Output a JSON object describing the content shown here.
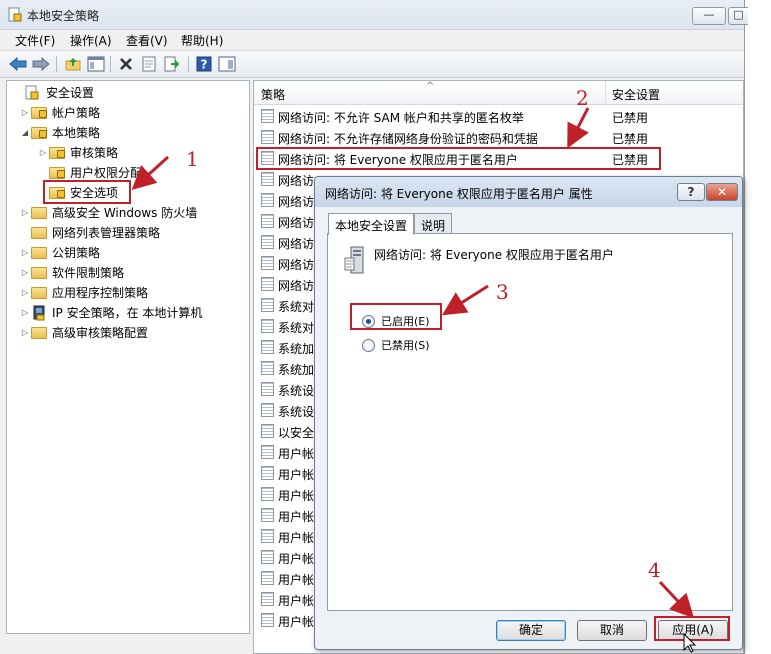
{
  "window": {
    "title": "本地安全策略",
    "minimize": "—",
    "maximize": "□"
  },
  "menu": [
    "文件(F)",
    "操作(A)",
    "查看(V)",
    "帮助(H)"
  ],
  "toolbar": {
    "icons": [
      "back-arrow-icon",
      "forward-arrow-icon",
      "up-folder-icon",
      "show-tree-icon",
      "delete-icon",
      "properties-icon",
      "export-icon",
      "help-icon",
      "panel-icon"
    ],
    "help_glyph": "?"
  },
  "tree": {
    "items": [
      {
        "label": "安全设置",
        "level": 0,
        "expander": "",
        "icon": "security-settings-icon"
      },
      {
        "label": "帐户策略",
        "level": 1,
        "expander": "▷",
        "icon": "folder-icon"
      },
      {
        "label": "本地策略",
        "level": 1,
        "expander": "◢",
        "icon": "folder-icon"
      },
      {
        "label": "审核策略",
        "level": 2,
        "expander": "▷",
        "icon": "folder-icon"
      },
      {
        "label": "用户权限分配",
        "level": 2,
        "expander": "",
        "icon": "folder-icon"
      },
      {
        "label": "安全选项",
        "level": 2,
        "expander": "",
        "icon": "folder-icon",
        "selected": true
      },
      {
        "label": "高级安全 Windows 防火墙",
        "level": 1,
        "expander": "▷",
        "icon": "folder-icon"
      },
      {
        "label": "网络列表管理器策略",
        "level": 1,
        "expander": "",
        "icon": "folder-icon"
      },
      {
        "label": "公钥策略",
        "level": 1,
        "expander": "▷",
        "icon": "folder-icon"
      },
      {
        "label": "软件限制策略",
        "level": 1,
        "expander": "▷",
        "icon": "folder-icon"
      },
      {
        "label": "应用程序控制策略",
        "level": 1,
        "expander": "▷",
        "icon": "folder-icon"
      },
      {
        "label": "IP 安全策略，在 本地计算机",
        "level": 1,
        "expander": "▷",
        "icon": "ip-security-icon"
      },
      {
        "label": "高级审核策略配置",
        "level": 1,
        "expander": "▷",
        "icon": "folder-icon"
      }
    ]
  },
  "list": {
    "columns": {
      "policy": "策略",
      "setting": "安全设置"
    },
    "sort_glyph": "^",
    "rows": [
      {
        "name": "网络访问: 不允许 SAM 帐户和共享的匿名枚举",
        "value": "已禁用"
      },
      {
        "name": "网络访问: 不允许存储网络身份验证的密码和凭据",
        "value": "已禁用"
      },
      {
        "name": "网络访问: 将 Everyone 权限应用于匿名用户",
        "value": "已禁用",
        "highlighted": true
      },
      {
        "name": "网络访",
        "value": ""
      },
      {
        "name": "网络访",
        "value": ""
      },
      {
        "name": "网络访",
        "value": ""
      },
      {
        "name": "网络访",
        "value": ""
      },
      {
        "name": "网络访",
        "value": ""
      },
      {
        "name": "网络访",
        "value": ""
      },
      {
        "name": "系统对",
        "value": ""
      },
      {
        "name": "系统对",
        "value": ""
      },
      {
        "name": "系统加",
        "value": ""
      },
      {
        "name": "系统加",
        "value": ""
      },
      {
        "name": "系统设",
        "value": ""
      },
      {
        "name": "系统设",
        "value": ""
      },
      {
        "name": "以安全",
        "value": ""
      },
      {
        "name": "用户帐",
        "value": ""
      },
      {
        "name": "用户帐",
        "value": ""
      },
      {
        "name": "用户帐",
        "value": ""
      },
      {
        "name": "用户帐",
        "value": ""
      },
      {
        "name": "用户帐",
        "value": ""
      },
      {
        "name": "用户帐",
        "value": ""
      },
      {
        "name": "用户帐",
        "value": ""
      },
      {
        "name": "用户帐",
        "value": ""
      },
      {
        "name": "用户帐",
        "value": ""
      }
    ]
  },
  "dialog": {
    "title": "网络访问: 将 Everyone 权限应用于匿名用户 属性",
    "help": "?",
    "close": "✕",
    "tabs": [
      "本地安全设置",
      "说明"
    ],
    "policy_name": "网络访问: 将 Everyone 权限应用于匿名用户",
    "options": [
      {
        "label": "已启用(E)",
        "checked": true
      },
      {
        "label": "已禁用(S)",
        "checked": false
      }
    ],
    "buttons": {
      "ok": "确定",
      "cancel": "取消",
      "apply": "应用(A)"
    }
  },
  "annotations": [
    "1",
    "2",
    "3",
    "4"
  ],
  "colors": {
    "annotation": "#c0202a",
    "selection": "#cce8ff"
  }
}
